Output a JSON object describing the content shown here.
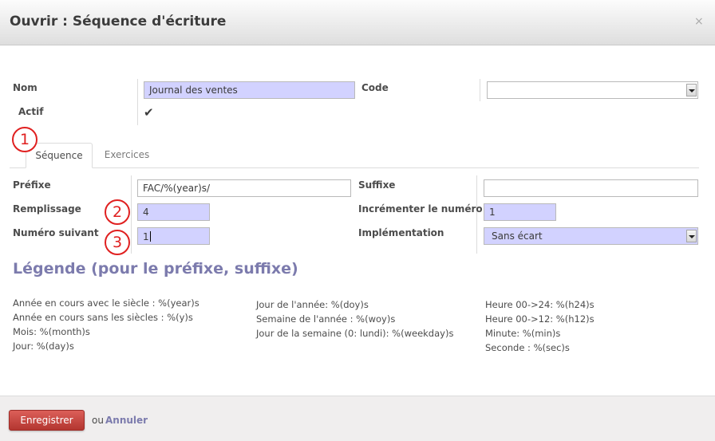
{
  "dialog": {
    "title": "Ouvrir : Séquence d'écriture",
    "close": "×"
  },
  "header_fields": {
    "nom_label": "Nom",
    "nom_value": "Journal des ventes",
    "code_label": "Code",
    "code_value": "",
    "actif_label": "Actif",
    "actif_checked": true,
    "actif_mark": "✔"
  },
  "tabs": [
    {
      "label": "Séquence",
      "active": true
    },
    {
      "label": "Exercices",
      "active": false
    }
  ],
  "sequence": {
    "prefixe_label": "Préfixe",
    "prefixe_value": "FAC/%(year)s/",
    "suffixe_label": "Suffixe",
    "suffixe_value": "",
    "remplissage_label": "Remplissage",
    "remplissage_value": "4",
    "increment_label": "Incrémenter le numéro",
    "increment_value": "1",
    "numero_label": "Numéro suivant",
    "numero_value": "1",
    "implementation_label": "Implémentation",
    "implementation_value": "Sans écart"
  },
  "annotations": [
    "1",
    "2",
    "3"
  ],
  "legend": {
    "title": "Légende (pour le préfixe, suffixe)",
    "col1": [
      "Année en cours avec le siècle : %(year)s",
      "Année en cours sans les siècles : %(y)s",
      "Mois: %(month)s",
      "Jour: %(day)s"
    ],
    "col2": [
      "Jour de l'année: %(doy)s",
      "Semaine de l'année : %(woy)s",
      "Jour de la semaine (0: lundi): %(weekday)s"
    ],
    "col3": [
      "Heure 00->24: %(h24)s",
      "Heure 00->12: %(h12)s",
      "Minute: %(min)s",
      "Seconde : %(sec)s"
    ]
  },
  "footer": {
    "save_label": "Enregistrer",
    "or_label": "ou",
    "cancel_label": "Annuler"
  },
  "colors": {
    "required_field": "#d2d2ff",
    "accent": "#7c7bad",
    "save_button": "#c7433d",
    "annotation": "#e02020"
  }
}
